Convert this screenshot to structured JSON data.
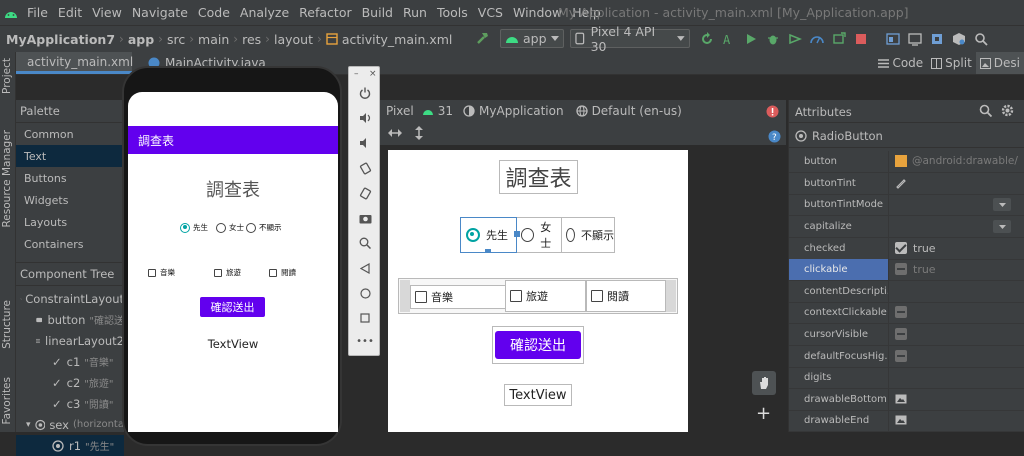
{
  "menu": [
    "File",
    "Edit",
    "View",
    "Navigate",
    "Code",
    "Analyze",
    "Refactor",
    "Build",
    "Run",
    "Tools",
    "VCS",
    "Window",
    "Help"
  ],
  "window_title": "My Application - activity_main.xml [My_Application.app]",
  "breadcrumbs": [
    "MyApplication7",
    "app",
    "src",
    "main",
    "res",
    "layout",
    "activity_main.xml"
  ],
  "run_config": "app",
  "device": "Pixel 4 API 30",
  "tabs": [
    "activity_main.xml",
    "MainActivity.java"
  ],
  "view_modes": {
    "code": "Code",
    "split": "Split",
    "design": "Desi"
  },
  "palette": {
    "title": "Palette",
    "items": [
      "Common",
      "Text",
      "Buttons",
      "Widgets",
      "Layouts",
      "Containers"
    ]
  },
  "component_tree": {
    "title": "Component Tree",
    "items": [
      {
        "label": "ConstraintLayout",
        "hint": ""
      },
      {
        "label": "button",
        "hint": "\"確認送"
      },
      {
        "label": "linearLayout2",
        "hint": ""
      },
      {
        "label": "c1",
        "hint": "\"音樂\""
      },
      {
        "label": "c2",
        "hint": "\"旅遊\""
      },
      {
        "label": "c3",
        "hint": "\"閱讀\""
      },
      {
        "label": "sex",
        "hint": "(horizonta"
      },
      {
        "label": "r1",
        "hint": "\"先生\""
      }
    ]
  },
  "left_strip": {
    "project": "Project",
    "resource_manager": "Resource Manager",
    "structure": "Structure",
    "favorites": "Favorites"
  },
  "emulator_app": {
    "appbar_title": "調查表",
    "heading": "調查表",
    "radios": [
      "先生",
      "女士",
      "不顯示"
    ],
    "checks": [
      "音樂",
      "旅遊",
      "閱讀"
    ],
    "button": "確認送出",
    "textview": "TextView"
  },
  "design_toolbar": {
    "device": "Pixel",
    "api": "31",
    "theme": "MyApplication",
    "locale": "Default (en-us)"
  },
  "blueprint": {
    "heading": "調查表",
    "radios": [
      "先生",
      "女士",
      "不顯示"
    ],
    "checks": [
      "音樂",
      "旅遊",
      "閱讀"
    ],
    "button": "確認送出",
    "textview": "TextView"
  },
  "attributes": {
    "title": "Attributes",
    "component": "RadioButton",
    "rows": [
      {
        "name": "button",
        "value": "@android:drawable/"
      },
      {
        "name": "buttonTint",
        "value": ""
      },
      {
        "name": "buttonTintMode",
        "value": ""
      },
      {
        "name": "capitalize",
        "value": ""
      },
      {
        "name": "checked",
        "value": "true"
      },
      {
        "name": "clickable",
        "value": "true"
      },
      {
        "name": "contentDescripti...",
        "value": ""
      },
      {
        "name": "contextClickable",
        "value": ""
      },
      {
        "name": "cursorVisible",
        "value": ""
      },
      {
        "name": "defaultFocusHig...",
        "value": ""
      },
      {
        "name": "digits",
        "value": ""
      },
      {
        "name": "drawableBottom",
        "value": ""
      },
      {
        "name": "drawableEnd",
        "value": ""
      }
    ]
  },
  "colors": {
    "primary": "#6200ee",
    "accent": "#00a3a3",
    "ide_bg": "#2b2b2b",
    "panel": "#3c3f41",
    "selection": "#4b6eaf"
  }
}
